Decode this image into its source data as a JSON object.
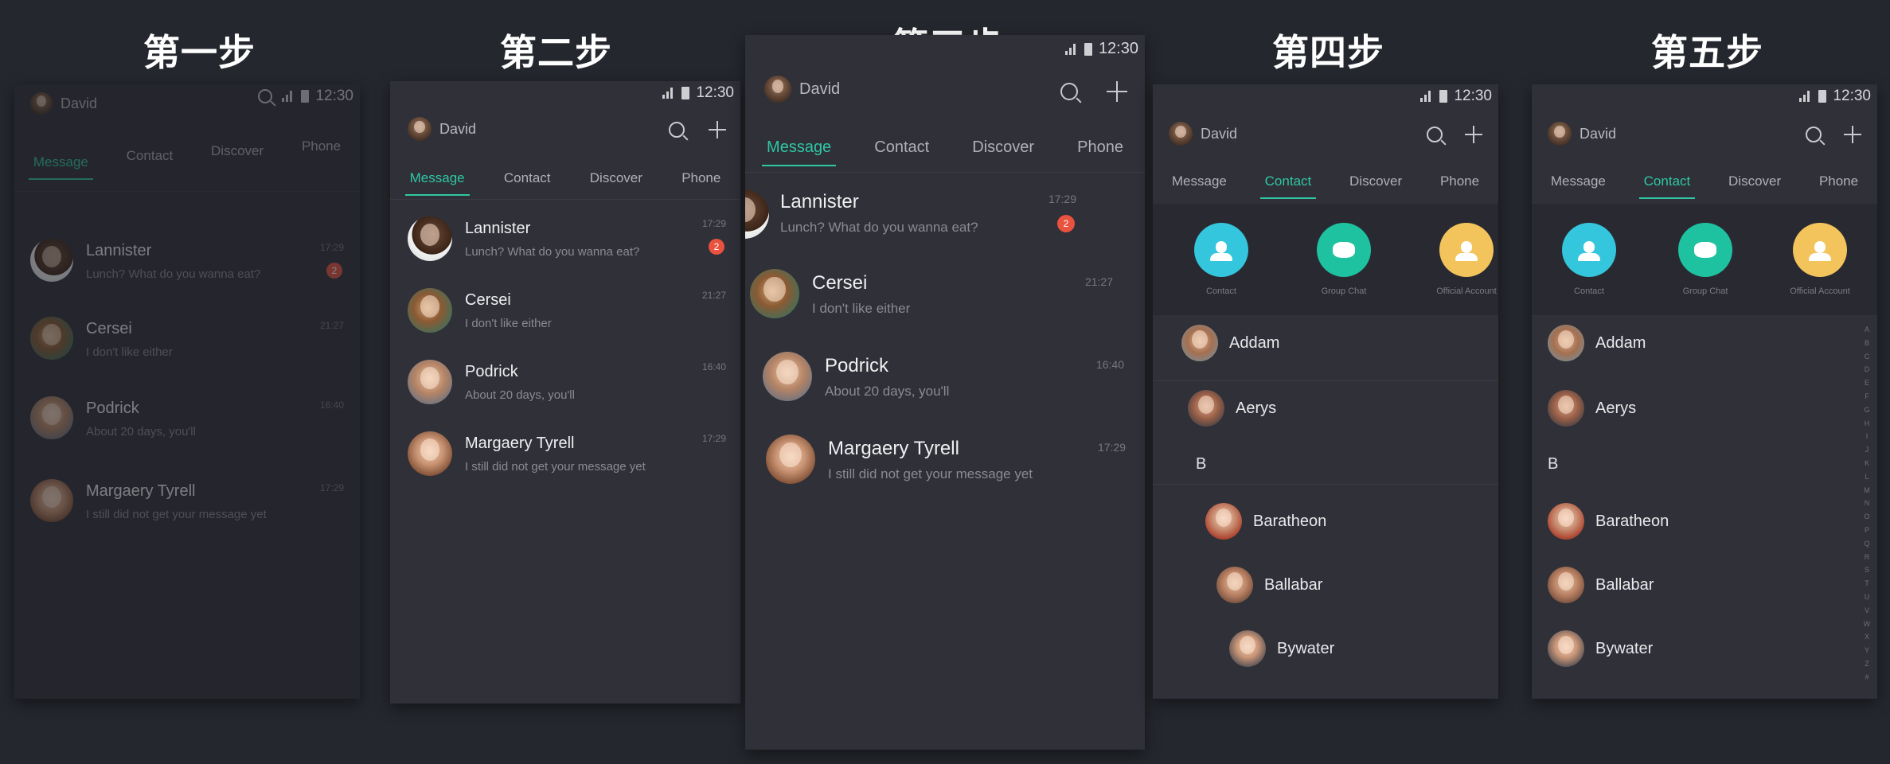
{
  "steps": [
    "第一步",
    "第二步",
    "第三步",
    "第四步",
    "第五步"
  ],
  "user": {
    "name": "David"
  },
  "status_time": "12:30",
  "tabs": [
    "Message",
    "Contact",
    "Discover",
    "Phone"
  ],
  "messages": [
    {
      "name": "Lannister",
      "preview": "Lunch? What do you wanna eat?",
      "time": "17:29",
      "badge": "2"
    },
    {
      "name": "Cersei",
      "preview": "I don't like either",
      "time": "21:27",
      "badge": ""
    },
    {
      "name": "Podrick",
      "preview": "About 20 days, you'll",
      "time": "16:40",
      "badge": ""
    },
    {
      "name": "Margaery Tyrell",
      "preview": "I still did not get your message yet",
      "time": "17:29",
      "badge": ""
    }
  ],
  "contact_actions": [
    {
      "label": "Contact",
      "color": "#34c6dc",
      "icon": "person-icon"
    },
    {
      "label": "Group Chat",
      "color": "#1ec2a1",
      "icon": "chat-icon"
    },
    {
      "label": "Official Account",
      "color": "#f3c45c",
      "icon": "person-icon"
    }
  ],
  "contacts": {
    "a_list": [
      "Addam",
      "Aerys"
    ],
    "section_b": "B",
    "b_list": [
      "Baratheon",
      "Ballabar",
      "Bywater"
    ]
  },
  "alphabet": [
    "A",
    "B",
    "C",
    "D",
    "E",
    "F",
    "G",
    "H",
    "I",
    "J",
    "K",
    "L",
    "M",
    "N",
    "O",
    "P",
    "Q",
    "R",
    "S",
    "T",
    "U",
    "V",
    "W",
    "X",
    "Y",
    "Z",
    "#"
  ]
}
